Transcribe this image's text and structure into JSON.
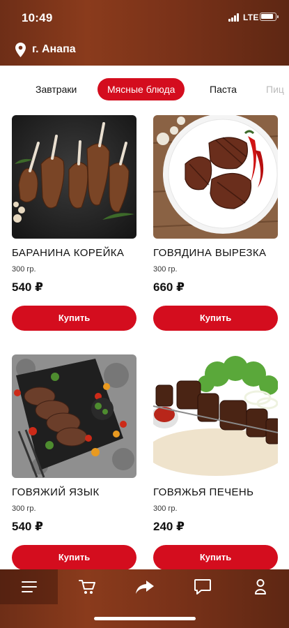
{
  "status_bar": {
    "time": "10:49",
    "network": "LTE"
  },
  "location": {
    "city": "г. Анапа"
  },
  "categories": [
    {
      "label": "Завтраки"
    },
    {
      "label": "Мясные блюда"
    },
    {
      "label": "Паста"
    },
    {
      "label": "Пиц"
    }
  ],
  "active_category": "Мясные блюда",
  "products": [
    {
      "name": "БАРАНИНА КОРЕЙКА",
      "weight": "300 гр.",
      "price": "540 ₽",
      "buy_label": "Купить"
    },
    {
      "name": "ГОВЯДИНА ВЫРЕЗКА",
      "weight": "300 гр.",
      "price": "660 ₽",
      "buy_label": "Купить"
    },
    {
      "name": "ГОВЯЖИЙ ЯЗЫК",
      "weight": "300 гр.",
      "price": "540 ₽",
      "buy_label": "Купить"
    },
    {
      "name": "ГОВЯЖЬЯ ПЕЧЕНЬ",
      "weight": "300 гр.",
      "price": "240 ₽",
      "buy_label": "Купить"
    }
  ],
  "bottom_nav": [
    {
      "icon": "menu-icon"
    },
    {
      "icon": "cart-icon"
    },
    {
      "icon": "share-icon"
    },
    {
      "icon": "chat-icon"
    },
    {
      "icon": "profile-icon"
    }
  ],
  "colors": {
    "accent": "#d40d1e",
    "header": "#7a3219"
  }
}
